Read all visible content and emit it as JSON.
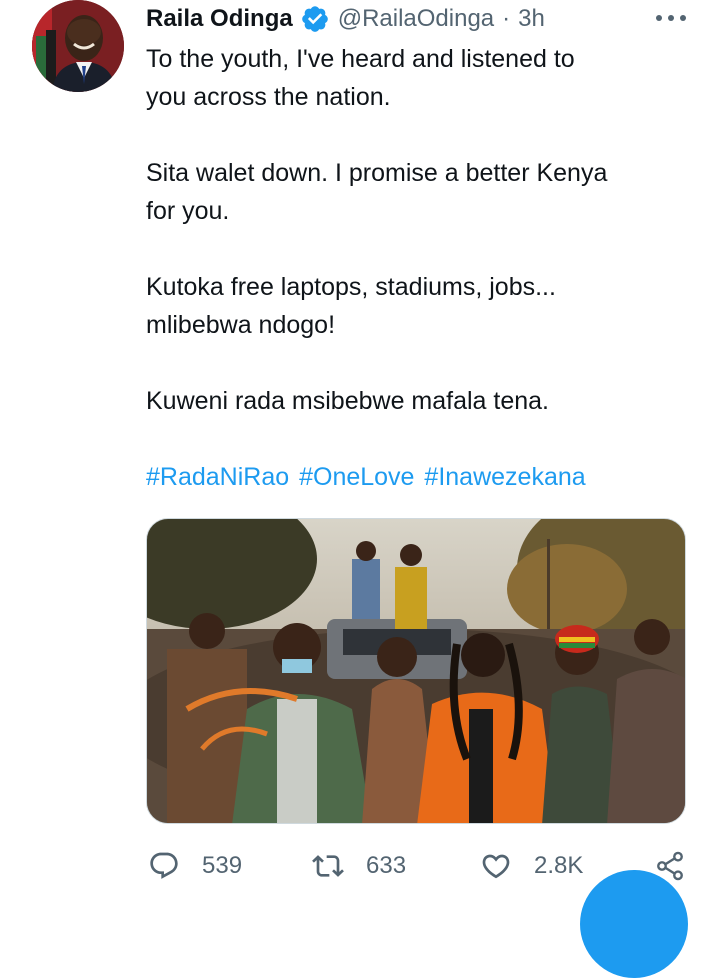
{
  "tweet": {
    "author": {
      "name": "Raila Odinga",
      "handle": "@RailaOdinga",
      "verified": true
    },
    "separator": "·",
    "time": "3h",
    "paragraphs": [
      [
        "To the youth, I've heard and  listened to",
        "you across the nation."
      ],
      [
        "Sita walet down. I promise a better Kenya",
        "for you."
      ],
      [
        "Kutoka free laptops, stadiums, jobs...",
        "mlibebwa ndogo!"
      ],
      [
        "Kuweni rada msibebwe mafala tena."
      ]
    ],
    "hashtags": [
      "#RadaNiRao",
      "#OneLove",
      "#Inawezekana"
    ],
    "stats": {
      "replies": "539",
      "retweets": "633",
      "likes": "2.8K"
    }
  },
  "colors": {
    "accent": "#1d9bf0",
    "text": "#0f1419",
    "muted": "#536471",
    "verified_badge": "#1d9bf0"
  },
  "icons": {
    "more": "more-icon",
    "reply": "reply-icon",
    "retweet": "retweet-icon",
    "like": "like-icon",
    "share": "share-icon",
    "verified": "verified-badge-icon"
  }
}
